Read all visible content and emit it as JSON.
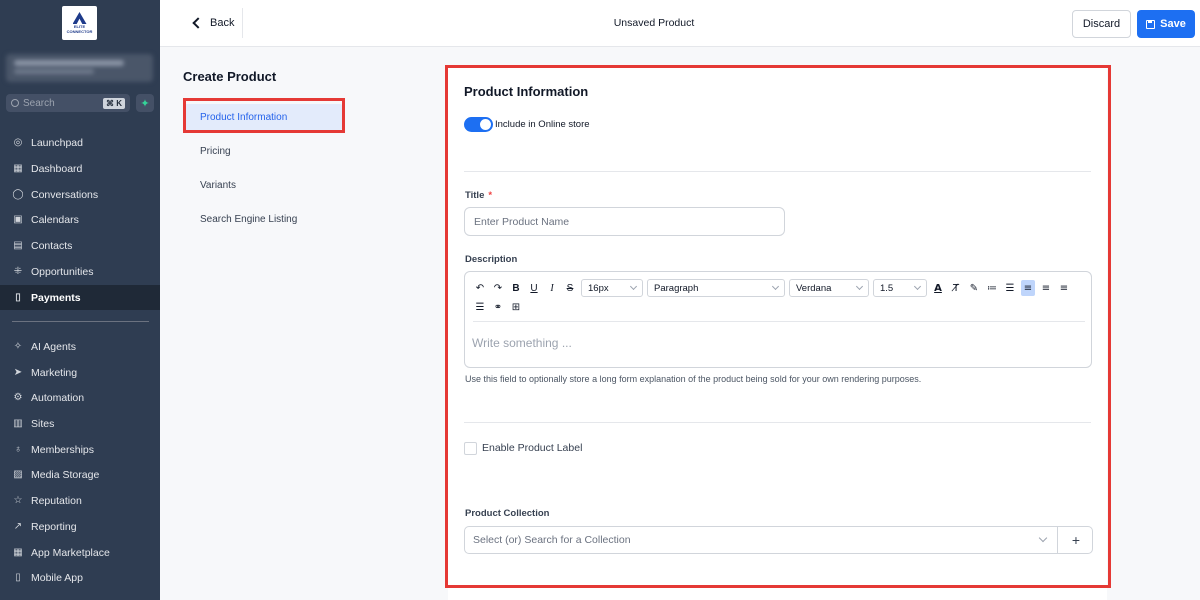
{
  "sidebar": {
    "logo_text": "ELITE CONNECTOR",
    "search_placeholder": "Search",
    "search_shortcut": "⌘ K",
    "nav_items": [
      {
        "label": "Launchpad",
        "icon": "rocket-icon"
      },
      {
        "label": "Dashboard",
        "icon": "grid-icon"
      },
      {
        "label": "Conversations",
        "icon": "chat-icon"
      },
      {
        "label": "Calendars",
        "icon": "calendar-icon"
      },
      {
        "label": "Contacts",
        "icon": "contact-card-icon"
      },
      {
        "label": "Opportunities",
        "icon": "nodes-icon"
      },
      {
        "label": "Payments",
        "icon": "receipt-icon",
        "active": true
      },
      {
        "label": "AI Agents",
        "icon": "sparkle-icon"
      },
      {
        "label": "Marketing",
        "icon": "send-icon"
      },
      {
        "label": "Automation",
        "icon": "gear-icon"
      },
      {
        "label": "Sites",
        "icon": "globe-icon"
      },
      {
        "label": "Memberships",
        "icon": "ribbon-icon"
      },
      {
        "label": "Media Storage",
        "icon": "image-icon"
      },
      {
        "label": "Reputation",
        "icon": "star-icon"
      },
      {
        "label": "Reporting",
        "icon": "trend-icon"
      },
      {
        "label": "App Marketplace",
        "icon": "apps-icon"
      },
      {
        "label": "Mobile App",
        "icon": "phone-icon"
      }
    ]
  },
  "header": {
    "back_label": "Back",
    "title": "Unsaved Product",
    "discard_label": "Discard",
    "save_label": "Save"
  },
  "panel": {
    "title": "Create Product",
    "items": [
      {
        "label": "Product Information",
        "selected": true
      },
      {
        "label": "Pricing"
      },
      {
        "label": "Variants"
      },
      {
        "label": "Search Engine Listing"
      }
    ]
  },
  "form": {
    "section_title": "Product Information",
    "online_store_label": "Include in Online store",
    "online_store_enabled": true,
    "title_label": "Title",
    "title_required_mark": "*",
    "title_placeholder": "Enter Product Name",
    "title_value": "",
    "description_label": "Description",
    "editor": {
      "font_size": "16px",
      "block_type": "Paragraph",
      "font_family": "Verdana",
      "line_height": "1.5",
      "placeholder": "Write something ...",
      "alignment_active": "left"
    },
    "description_help": "Use this field to optionally store a long form explanation of the product being sold for your own rendering purposes.",
    "product_label_checkbox": "Enable Product Label",
    "product_label_checked": false,
    "collection_label": "Product Collection",
    "collection_placeholder": "Select (or) Search for a Collection",
    "collection_add": "+"
  },
  "colors": {
    "sidebar_bg": "#2f3d52",
    "accent": "#1d6ff2",
    "highlight_box": "#e53935",
    "selected_nav_bg": "#e3ebfb"
  }
}
